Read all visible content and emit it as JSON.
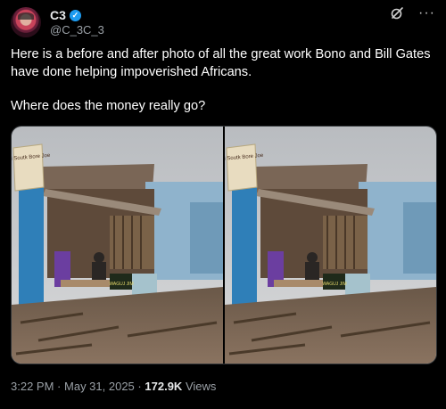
{
  "author": {
    "display_name": "C3",
    "handle": "@C_3C_3",
    "verified": true
  },
  "tweet": {
    "paragraph1": "Here is a before and after photo of all the great work Bono and Bill Gates have done helping impoverished Africans.",
    "paragraph2": "Where does the money really go?"
  },
  "media": {
    "photos": [
      {
        "sign_text": "Nil Soutk Bore Joe"
      },
      {
        "sign_text": "Nil Soutk Bore Joe"
      }
    ],
    "banner_text": "WAGUJ JIM"
  },
  "meta": {
    "time": "3:22 PM",
    "date": "May 31, 2025",
    "separator": "·",
    "views_count": "172.9K",
    "views_label": "Views"
  },
  "icons": {
    "verified": "verified-badge-icon",
    "grok": "grok-icon",
    "more": "more-options-icon"
  },
  "colors": {
    "background": "#000000",
    "text": "#e7e9ea",
    "muted": "#9aa0a6",
    "verified": "#1d9bf0"
  }
}
